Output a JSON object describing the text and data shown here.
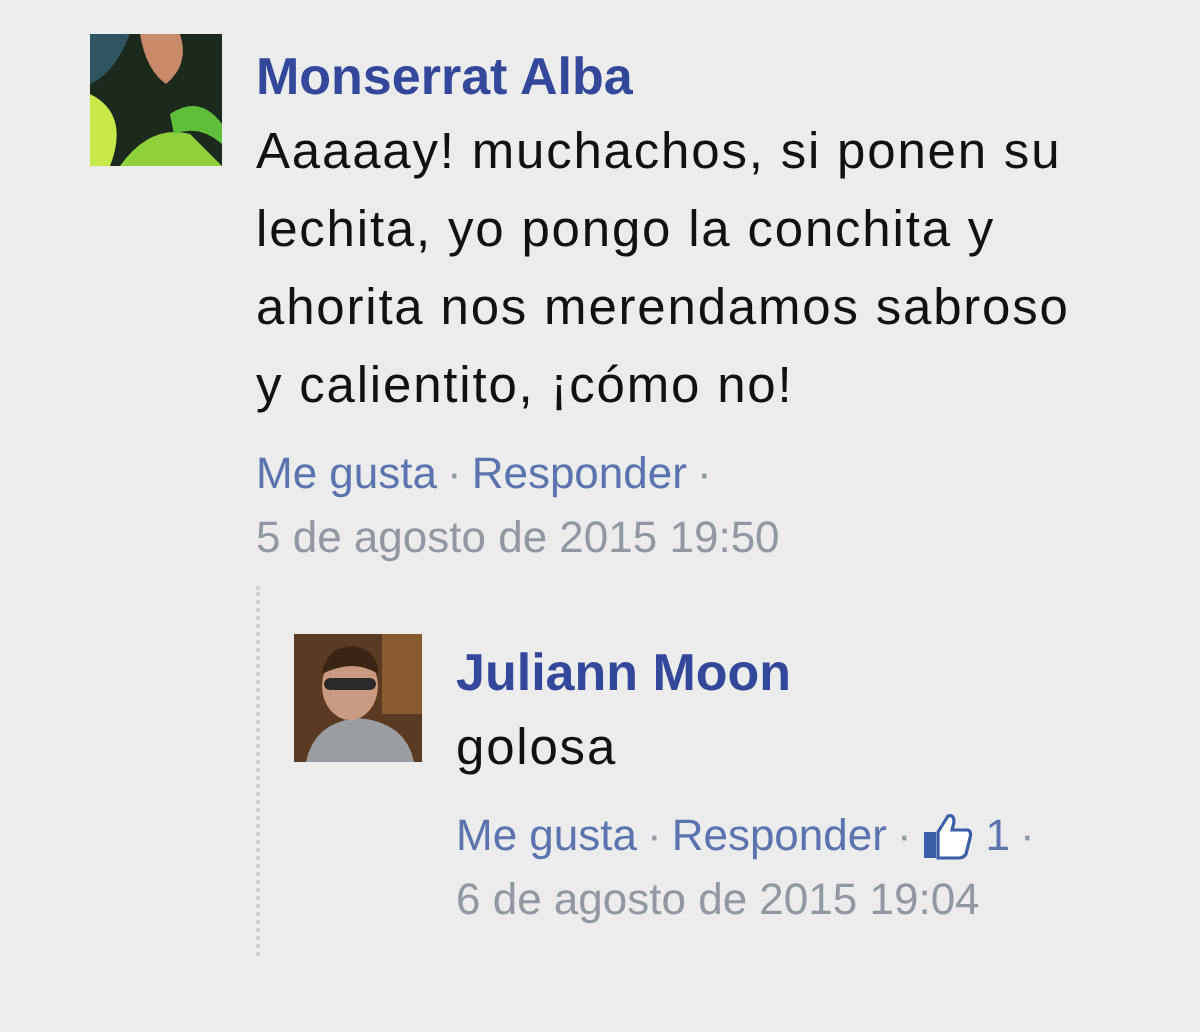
{
  "comment": {
    "author": "Monserrat Alba",
    "text": "Aaaaay! muchachos, si ponen su lechita, yo pongo la conchita y ahorita nos merendamos sabroso y calientito, ¡cómo no!",
    "meta": [
      {
        "kind": "link",
        "text": "Me gusta"
      },
      {
        "kind": "sep",
        "text": "·"
      },
      {
        "kind": "link",
        "text": "Responder"
      },
      {
        "kind": "sep",
        "text": "·"
      },
      {
        "kind": "time",
        "text": "5 de agosto de 2015 19:50"
      }
    ],
    "replies": [
      {
        "author": "Juliann Moon",
        "text": "golosa",
        "meta": [
          {
            "kind": "link",
            "text": "Me gusta"
          },
          {
            "kind": "sep",
            "text": "·"
          },
          {
            "kind": "link",
            "text": "Responder"
          },
          {
            "kind": "sep",
            "text": "·"
          },
          {
            "kind": "likes",
            "text": "1"
          },
          {
            "kind": "sep",
            "text": "·"
          },
          {
            "kind": "time",
            "text": "6 de agosto de 2015 19:04"
          }
        ]
      }
    ]
  }
}
